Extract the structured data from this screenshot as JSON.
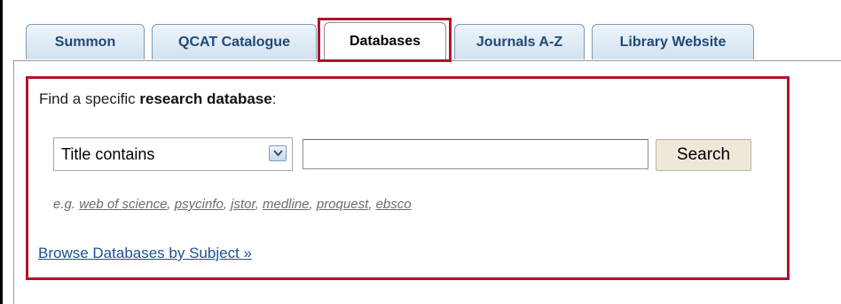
{
  "tabs": [
    {
      "label": "Summon"
    },
    {
      "label": "QCAT Catalogue"
    },
    {
      "label": "Databases"
    },
    {
      "label": "Journals A-Z"
    },
    {
      "label": "Library Website"
    }
  ],
  "active_tab": "Databases",
  "panel": {
    "heading_prefix": "Find a specific ",
    "heading_bold": "research database",
    "heading_suffix": ":",
    "select_value": "Title contains",
    "search_value": "",
    "search_button": "Search",
    "examples_prefix": "e.g. ",
    "examples": [
      "web of science",
      "psycinfo",
      "jstor",
      "medline",
      "proquest",
      "ebsco"
    ],
    "browse_link": "Browse Databases by Subject »"
  },
  "colors": {
    "highlight": "#b0142a",
    "tab_text": "#1e4a78",
    "link": "#1c4f96"
  }
}
